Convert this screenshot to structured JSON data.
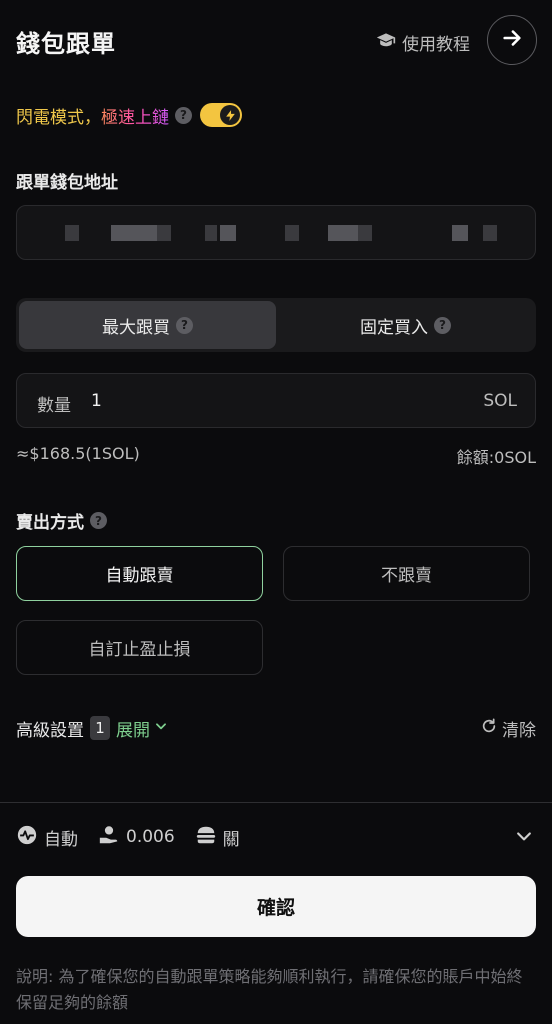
{
  "header": {
    "title": "錢包跟單",
    "tutorial_label": "使用教程"
  },
  "flash": {
    "mode_label": "閃電模式，",
    "speed_label": "極速上鏈",
    "help_glyph": "?",
    "toggle_on": true
  },
  "wallet": {
    "label": "跟單錢包地址"
  },
  "buy_mode": {
    "options": [
      {
        "label": "最大跟買",
        "help": "?",
        "active": true
      },
      {
        "label": "固定買入",
        "help": "?",
        "active": false
      }
    ]
  },
  "quantity": {
    "label": "數量",
    "value": "1",
    "unit": "SOL",
    "approx": "≈$168.5(1SOL)",
    "balance": "餘額:0SOL"
  },
  "sell": {
    "label": "賣出方式",
    "help": "?",
    "options": [
      {
        "label": "自動跟賣",
        "active": true
      },
      {
        "label": "不跟賣",
        "active": false
      },
      {
        "label": "自訂止盈止損",
        "active": false
      }
    ]
  },
  "advanced": {
    "label": "高級設置",
    "count": "1",
    "expand_label": "展開",
    "clear_label": "清除"
  },
  "footer": {
    "gas_mode": "自動",
    "tip_value": "0.006",
    "mev_label": "關"
  },
  "confirm_label": "確認",
  "note": "說明: 為了確保您的自動跟單策略能夠順利執行，請確保您的賬戶中始終保留足夠的餘額",
  "colors": {
    "accent_green": "#7ecf8e",
    "toggle_yellow": "#f3c540",
    "flash_yellow": "#f0c84b"
  }
}
